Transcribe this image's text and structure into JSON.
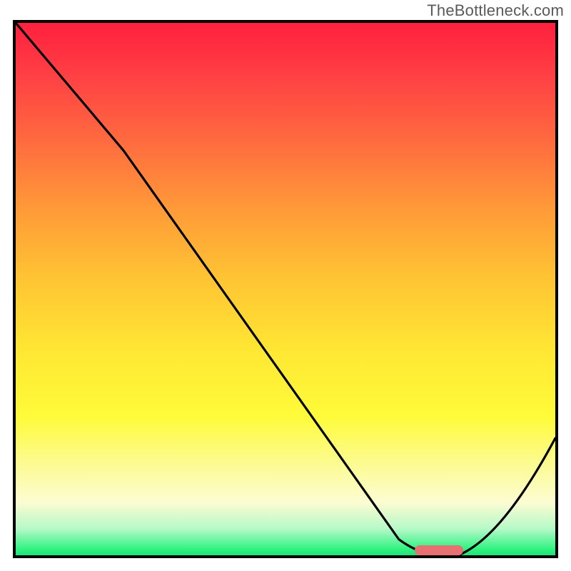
{
  "watermark": "TheBottleneck.com",
  "chart_data": {
    "type": "line",
    "title": "",
    "xlabel": "",
    "ylabel": "",
    "xlim": [
      0,
      100
    ],
    "ylim": [
      0,
      100
    ],
    "grid": false,
    "legend": false,
    "series": [
      {
        "name": "bottleneck-curve",
        "x": [
          0,
          20,
          71,
          79,
          82,
          100
        ],
        "y": [
          100,
          76,
          3,
          0,
          0,
          22
        ]
      }
    ],
    "marker": {
      "name": "optimal-range",
      "x_start": 74,
      "x_end": 83,
      "y": 0.9,
      "color": "#e77072"
    },
    "background_gradient": {
      "stops": [
        {
          "pos": 0,
          "color": "#ff203f"
        },
        {
          "pos": 10,
          "color": "#ff4044"
        },
        {
          "pos": 22,
          "color": "#ff6a3f"
        },
        {
          "pos": 35,
          "color": "#ff9a38"
        },
        {
          "pos": 48,
          "color": "#ffc433"
        },
        {
          "pos": 62,
          "color": "#ffe833"
        },
        {
          "pos": 74,
          "color": "#fffb3a"
        },
        {
          "pos": 82,
          "color": "#fcfb8a"
        },
        {
          "pos": 90,
          "color": "#fdfcd2"
        },
        {
          "pos": 95,
          "color": "#b6f9c8"
        },
        {
          "pos": 99,
          "color": "#2af27e"
        },
        {
          "pos": 100,
          "color": "#25e07a"
        }
      ]
    }
  }
}
